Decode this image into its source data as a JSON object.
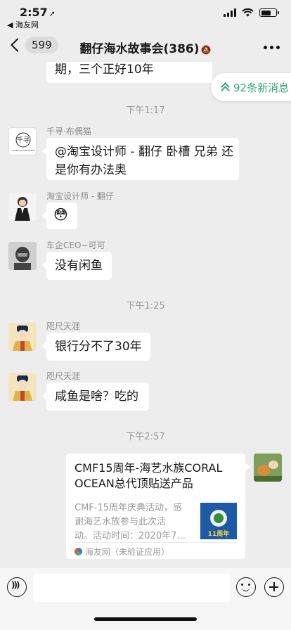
{
  "status_bar": {
    "time": "2:57",
    "back_app": "◀ 海友网"
  },
  "nav": {
    "unread_count": "599",
    "title": "翻仔海水故事会(386)"
  },
  "new_messages": "92条新消息",
  "messages": [
    {
      "kind": "text",
      "text": "期，三个正好10年"
    },
    {
      "kind": "time",
      "text": "下午1:17"
    },
    {
      "kind": "text",
      "sender": "千寻·布偶猫",
      "lines": [
        "@淘宝设计师 - 翻仔 卧槽 兄弟 还",
        "是你有办法奥"
      ],
      "avatar_text": "千寻",
      "avatar_caption": "QIANXUN HANDMADE"
    },
    {
      "kind": "text",
      "sender": "淘宝设计师 - 翻仔",
      "text": "😳"
    },
    {
      "kind": "text",
      "sender": "车企CEO~可可",
      "text": "没有闲鱼"
    },
    {
      "kind": "time",
      "text": "下午1:25"
    },
    {
      "kind": "text",
      "sender": "咫尺天涯",
      "text": "银行分不了30年"
    },
    {
      "kind": "text",
      "sender": "咫尺天涯",
      "text": "咸鱼是啥？吃的"
    },
    {
      "kind": "time",
      "text": "下午2:57"
    },
    {
      "kind": "link",
      "title_lines": [
        "CMF15周年-海艺水族CORAL",
        "OCEAN总代顶贴送产品"
      ],
      "desc_lines": [
        "CMF-15周年庆典活动，感",
        "谢海艺水族参与此次活",
        "动。活动时间：2020年7..."
      ],
      "source": "海友网（未验证应用）",
      "thumb_text": "11周年"
    }
  ],
  "colors": {
    "background": "#ededed",
    "accent_green": "#3aa17e",
    "bubble": "#ffffff"
  }
}
